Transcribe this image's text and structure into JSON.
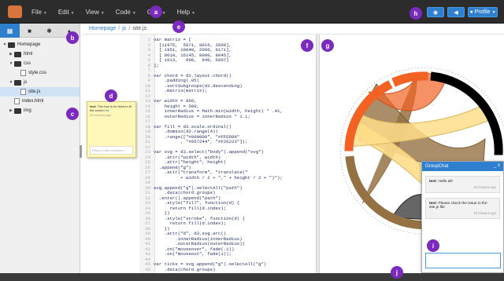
{
  "menu": [
    {
      "label": "File"
    },
    {
      "label": "Edit"
    },
    {
      "label": "View"
    },
    {
      "label": "Code"
    },
    {
      "label": "Chat"
    },
    {
      "label": "Help"
    }
  ],
  "toolbar": {
    "eye_icon": "eye-icon",
    "megaphone_icon": "megaphone-icon",
    "profile_label": "Profile"
  },
  "markers": {
    "a": "a",
    "b": "b",
    "c": "c",
    "d": "d",
    "e": "e",
    "f": "f",
    "g": "g",
    "h": "h",
    "i": "i",
    "j": "j"
  },
  "sidebar": {
    "tabs": [
      {
        "icon": "files-icon"
      },
      {
        "icon": "video-icon"
      },
      {
        "icon": "settings-icon"
      },
      {
        "icon": "globe-icon"
      }
    ],
    "tree": [
      {
        "label": "Homepage",
        "type": "folder",
        "depth": 0,
        "expanded": true
      },
      {
        "label": "html",
        "type": "folder",
        "depth": 1,
        "expanded": false
      },
      {
        "label": "css",
        "type": "folder",
        "depth": 1,
        "expanded": true
      },
      {
        "label": "style.css",
        "type": "file",
        "depth": 2
      },
      {
        "label": "js",
        "type": "folder",
        "depth": 1,
        "expanded": true
      },
      {
        "label": "site.js",
        "type": "file",
        "depth": 2,
        "selected": true
      },
      {
        "label": "index.html",
        "type": "file",
        "depth": 1
      },
      {
        "label": "img",
        "type": "folder",
        "depth": 1,
        "expanded": false
      }
    ]
  },
  "comment": {
    "author": "test:",
    "text": "This has to be fixed to fit the screen",
    "link": "fat",
    "time": "20 minutes ago",
    "reply_placeholder": "Reply to this comment..."
  },
  "breadcrumb": [
    "Homepage",
    "js",
    "site.js"
  ],
  "code": [
    {
      "n": "1",
      "t": "var matrix = ["
    },
    {
      "n": "2",
      "t": "  [11975,  5871, 8916, 2868],"
    },
    {
      "n": "3",
      "t": "  [ 1951, 10048, 2060, 6171],"
    },
    {
      "n": "4",
      "t": "  [ 8010, 16145, 8090, 8045],"
    },
    {
      "n": "5",
      "t": "  [ 1013,   990,  940, 6907]"
    },
    {
      "n": "6",
      "t": "];"
    },
    {
      "n": "7",
      "t": ""
    },
    {
      "n": "8",
      "t": "var chord = d3.layout.chord()"
    },
    {
      "n": "9",
      "t": "    .padding(.05)"
    },
    {
      "n": "10",
      "t": "    .sortSubgroups(d3.descending)"
    },
    {
      "n": "11",
      "t": "    .matrix(matrix);"
    },
    {
      "n": "12",
      "t": ""
    },
    {
      "n": "13",
      "t": "var width = 960,"
    },
    {
      "n": "14",
      "t": "    height = 500,"
    },
    {
      "n": "15",
      "t": "    innerRadius = Math.min(width, height) * .41,"
    },
    {
      "n": "16",
      "t": "    outerRadius = innerRadius * 1.1;"
    },
    {
      "n": "17",
      "t": ""
    },
    {
      "n": "18",
      "t": "var fill = d3.scale.ordinal()"
    },
    {
      "n": "19",
      "t": "    .domain(d3.range(4))"
    },
    {
      "n": "20",
      "t": "    .range([\"#000000\", \"#FFDD89\""
    },
    {
      "n": "21",
      "t": "          , \"#957244\", \"#F26223\"]);"
    },
    {
      "n": "22",
      "t": ""
    },
    {
      "n": "23",
      "t": "var svg = d3.select(\"body\").append(\"svg\")"
    },
    {
      "n": "24",
      "t": "    .attr(\"width\", width)"
    },
    {
      "n": "25",
      "t": "    .attr(\"height\", height)"
    },
    {
      "n": "26",
      "t": "  .append(\"g\")"
    },
    {
      "n": "27",
      "t": "    .attr(\"transform\", \"translate(\""
    },
    {
      "n": "28",
      "t": "          + width / 2 + \",\" + height / 2 + \")\");"
    },
    {
      "n": "29",
      "t": ""
    },
    {
      "n": "30",
      "t": "svg.append(\"g\").selectAll(\"path\")"
    },
    {
      "n": "31",
      "t": "    .data(chord.groups)"
    },
    {
      "n": "32",
      "t": "  .enter().append(\"path\")"
    },
    {
      "n": "33",
      "t": "    .style(\"fill\", function(d) {"
    },
    {
      "n": "34",
      "t": "      return fill(d.index);"
    },
    {
      "n": "35",
      "t": "    })"
    },
    {
      "n": "36",
      "t": "    .style(\"stroke\", function(d) {"
    },
    {
      "n": "37",
      "t": "      return fill(d.index);"
    },
    {
      "n": "38",
      "t": "    })"
    },
    {
      "n": "39",
      "t": "    .attr(\"d\", d3.svg.arc()"
    },
    {
      "n": "40",
      "t": "        .innerRadius(innerRadius)"
    },
    {
      "n": "41",
      "t": "        .outerRadius(outerRadius))"
    },
    {
      "n": "42",
      "t": "    .on(\"mouseover\", fade(.1))"
    },
    {
      "n": "43",
      "t": "    .on(\"mouseout\", fade(1));"
    },
    {
      "n": "44",
      "t": ""
    },
    {
      "n": "45",
      "t": "var ticks = svg.append(\"g\").selectAll(\"g\")"
    },
    {
      "n": "46",
      "t": "    .data(chord.groups)"
    }
  ],
  "chord_colors": [
    "#000000",
    "#FFDD89",
    "#957244",
    "#F26223"
  ],
  "chat": {
    "title": "GroupChat",
    "controls": "_ x",
    "messages": [
      {
        "author": "test:",
        "text": "Hello all!",
        "time": "20 minutes ago"
      },
      {
        "author": "test:",
        "text": "Please check the issue in the site.js file",
        "time": "20 minutes ago"
      }
    ]
  }
}
